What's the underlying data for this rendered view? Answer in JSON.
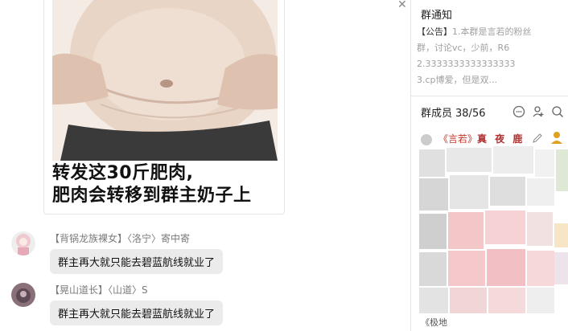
{
  "chat": {
    "meme": {
      "caption_line1": "转发这30斤肥肉,",
      "caption_line2": "肥肉会转移到群主奶子上"
    },
    "messages": [
      {
        "sender_tag": "【背锅龙族裸女】",
        "sender_alias": "〈洛宁〉",
        "sender_name": "寄中寄",
        "text": "群主再大就只能去碧蓝航线就业了"
      },
      {
        "sender_tag": "【晃山道长】",
        "sender_alias": "〈山道〉",
        "sender_name": "S",
        "text": "群主再大就只能去碧蓝航线就业了"
      }
    ]
  },
  "panel": {
    "notice_title": "群通知",
    "notice_tag": "【公告】",
    "notice_line1": "1.本群是言若的粉丝",
    "notice_line2": "群，讨论vc，少前，R6",
    "notice_line3": "2.3333333333333333",
    "notice_line4": "3.cp博爱，但是双...",
    "members_label": "群成员",
    "members_count": "38/56",
    "first_member_tag": "《言若》",
    "first_member_name": "真 夜 鹿",
    "last_member_partial": "《极地",
    "icons": [
      "chat-bubble-icon",
      "add-member-icon",
      "search-icon"
    ]
  },
  "colors": {
    "bubble": "#ebebeb",
    "sender": "#7a7a7a",
    "owner_tag": "#c0392b",
    "notice_text": "#a0a0a0",
    "mosaic_pink": "#f6c4c7"
  }
}
